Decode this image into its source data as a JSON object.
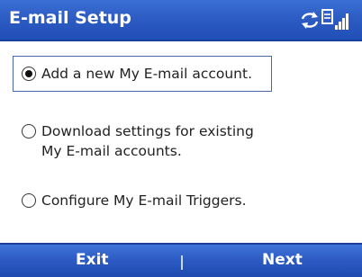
{
  "titlebar": {
    "title": "E-mail Setup",
    "icons": [
      "sync-arrows-icon",
      "data-connection-icon",
      "signal-strength-icon"
    ]
  },
  "options": [
    {
      "label": "Add a new My E-mail account.",
      "selected": true
    },
    {
      "label": "Download settings for existing\nMy E-mail accounts.",
      "selected": false
    },
    {
      "label": "Configure My E-mail Triggers.",
      "selected": false
    }
  ],
  "softkeys": {
    "left": "Exit",
    "right": "Next"
  },
  "colors": {
    "titlebar": "#2c5cc4",
    "softbar": "#2b5ac2",
    "focus_border": "#4a68b0",
    "text": "#222222"
  }
}
